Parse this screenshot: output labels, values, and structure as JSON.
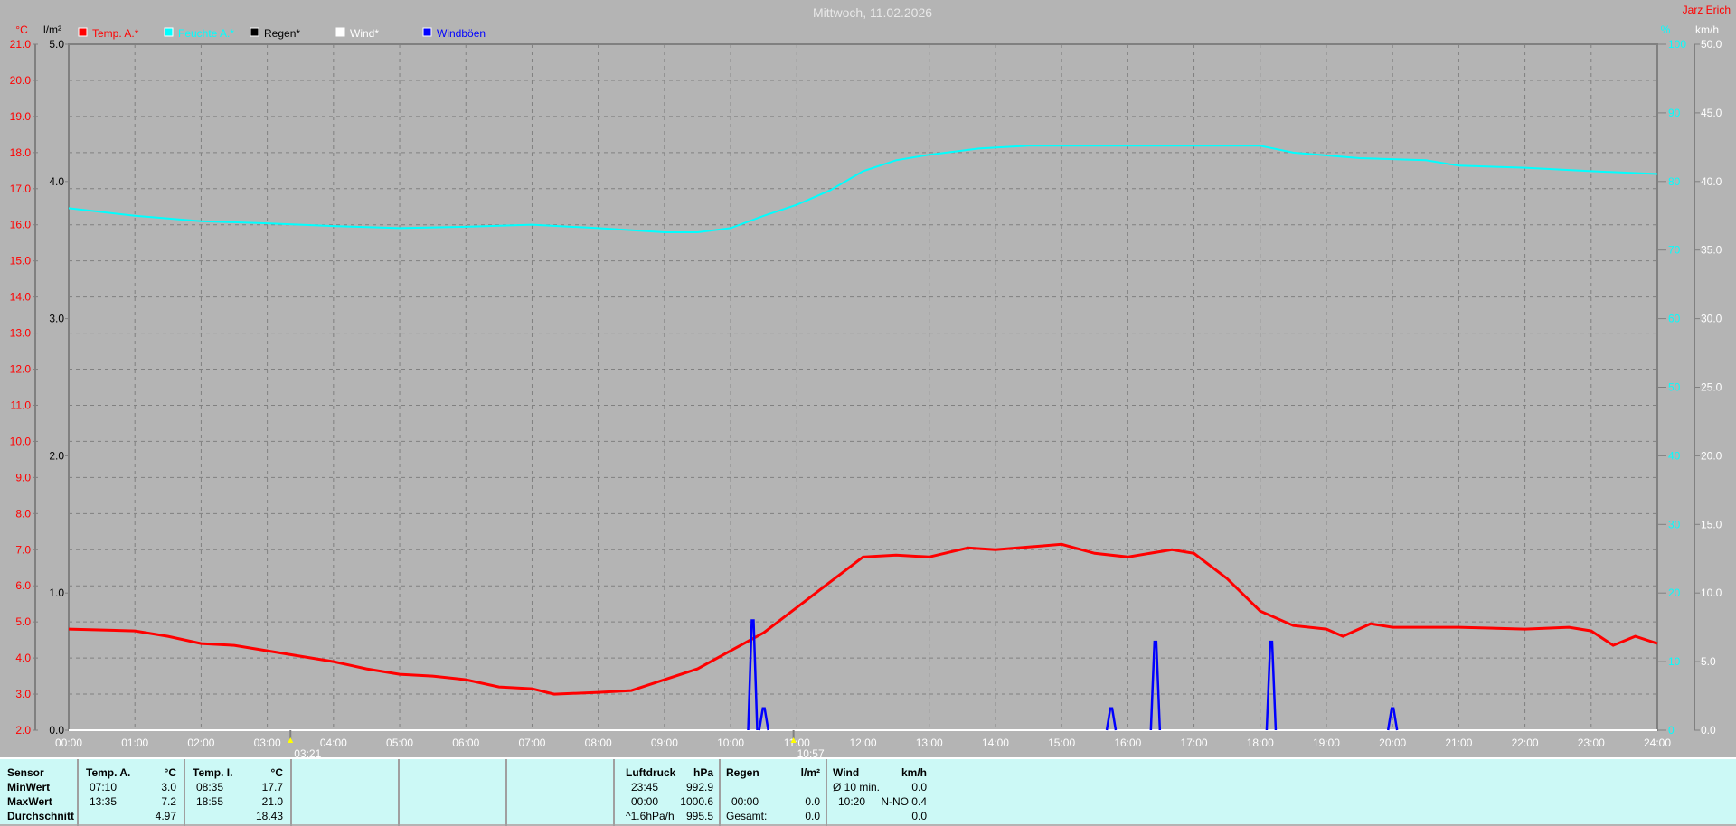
{
  "header": {
    "title": "Mittwoch, 11.02.2026",
    "station": "Jarz Erich"
  },
  "colors": {
    "temp": "#ff0000",
    "humidity": "#00ffff",
    "rain": "#000000",
    "wind": "#ffffff",
    "gusts": "#0000ff",
    "background": "#b4b4b4",
    "table_bg": "#ccf9f6"
  },
  "chart_data": {
    "type": "line",
    "title": "Mittwoch, 11.02.2026",
    "grid": true,
    "legend_placement": "top-left",
    "legend": [
      {
        "label": "Temp. A.*",
        "color": "#ff0000"
      },
      {
        "label": "Feuchte A.*",
        "color": "#00ffff"
      },
      {
        "label": "Regen*",
        "color": "#000000"
      },
      {
        "label": "Wind*",
        "color": "#ffffff"
      },
      {
        "label": "Windböen",
        "color": "#0000ff"
      }
    ],
    "axes": {
      "temp": {
        "unit": "°C",
        "range": [
          2.0,
          21.0
        ],
        "ticks": [
          "21.0",
          "20.0",
          "19.0",
          "18.0",
          "17.0",
          "16.0",
          "15.0",
          "14.0",
          "13.0",
          "12.0",
          "11.0",
          "10.0",
          "9.0",
          "8.0",
          "7.0",
          "6.0",
          "5.0",
          "4.0",
          "3.0",
          "2.0"
        ]
      },
      "rain": {
        "unit": "l/m²",
        "range": [
          0.0,
          5.0
        ],
        "ticks": [
          "5.0",
          "4.0",
          "3.0",
          "2.0",
          "1.0",
          "0.0"
        ]
      },
      "humidity": {
        "unit": "%",
        "range": [
          0,
          100
        ],
        "ticks": [
          "100",
          "90",
          "80",
          "70",
          "60",
          "50",
          "40",
          "30",
          "20",
          "10",
          "0"
        ]
      },
      "wind": {
        "unit": "km/h",
        "range": [
          0.0,
          50.0
        ],
        "ticks": [
          "50.0",
          "45.0",
          "40.0",
          "35.0",
          "30.0",
          "25.0",
          "20.0",
          "15.0",
          "10.0",
          "5.0",
          "0.0"
        ]
      },
      "x": {
        "ticks": [
          "00:00",
          "01:00",
          "02:00",
          "03:00",
          "04:00",
          "05:00",
          "06:00",
          "07:00",
          "08:00",
          "09:00",
          "10:00",
          "11:00",
          "12:00",
          "13:00",
          "14:00",
          "15:00",
          "16:00",
          "17:00",
          "18:00",
          "19:00",
          "20:00",
          "21:00",
          "22:00",
          "23:00",
          "24:00"
        ]
      }
    },
    "markers": [
      {
        "label": "03:21",
        "time": "03:21",
        "icon": "moonrise-icon"
      },
      {
        "label": "10:57",
        "time": "10:57",
        "icon": "moonset-icon"
      }
    ],
    "series": [
      {
        "name": "Temp. A.*",
        "axis": "temp",
        "points": [
          [
            "00:00",
            4.8
          ],
          [
            "01:00",
            4.75
          ],
          [
            "01:30",
            4.6
          ],
          [
            "02:00",
            4.4
          ],
          [
            "02:30",
            4.35
          ],
          [
            "03:00",
            4.2
          ],
          [
            "03:30",
            4.05
          ],
          [
            "04:00",
            3.9
          ],
          [
            "04:30",
            3.7
          ],
          [
            "05:00",
            3.55
          ],
          [
            "05:30",
            3.5
          ],
          [
            "06:00",
            3.4
          ],
          [
            "06:30",
            3.2
          ],
          [
            "07:00",
            3.15
          ],
          [
            "07:20",
            3.0
          ],
          [
            "08:00",
            3.05
          ],
          [
            "08:30",
            3.1
          ],
          [
            "09:00",
            3.4
          ],
          [
            "09:30",
            3.7
          ],
          [
            "10:00",
            4.2
          ],
          [
            "10:30",
            4.7
          ],
          [
            "11:00",
            5.4
          ],
          [
            "11:30",
            6.1
          ],
          [
            "12:00",
            6.8
          ],
          [
            "12:30",
            6.85
          ],
          [
            "13:00",
            6.8
          ],
          [
            "13:35",
            7.05
          ],
          [
            "14:00",
            7.0
          ],
          [
            "15:00",
            7.15
          ],
          [
            "15:30",
            6.9
          ],
          [
            "16:00",
            6.8
          ],
          [
            "16:40",
            7.0
          ],
          [
            "17:00",
            6.9
          ],
          [
            "17:30",
            6.2
          ],
          [
            "18:00",
            5.3
          ],
          [
            "18:30",
            4.9
          ],
          [
            "19:00",
            4.8
          ],
          [
            "19:15",
            4.6
          ],
          [
            "19:40",
            4.95
          ],
          [
            "20:00",
            4.85
          ],
          [
            "21:00",
            4.85
          ],
          [
            "22:00",
            4.8
          ],
          [
            "22:40",
            4.85
          ],
          [
            "23:00",
            4.75
          ],
          [
            "23:20",
            4.35
          ],
          [
            "23:40",
            4.6
          ],
          [
            "24:00",
            4.4
          ]
        ]
      },
      {
        "name": "Feuchte A.*",
        "axis": "humidity",
        "points": [
          [
            "00:00",
            76.1
          ],
          [
            "01:00",
            75.0
          ],
          [
            "02:00",
            74.2
          ],
          [
            "03:00",
            73.9
          ],
          [
            "04:00",
            73.5
          ],
          [
            "05:00",
            73.2
          ],
          [
            "06:00",
            73.4
          ],
          [
            "07:00",
            73.7
          ],
          [
            "08:00",
            73.2
          ],
          [
            "09:00",
            72.6
          ],
          [
            "09:30",
            72.6
          ],
          [
            "10:00",
            73.2
          ],
          [
            "10:30",
            75.0
          ],
          [
            "11:00",
            76.6
          ],
          [
            "11:30",
            78.7
          ],
          [
            "12:00",
            81.5
          ],
          [
            "12:30",
            83.1
          ],
          [
            "13:00",
            83.9
          ],
          [
            "13:45",
            84.8
          ],
          [
            "14:30",
            85.2
          ],
          [
            "18:00",
            85.2
          ],
          [
            "18:30",
            84.2
          ],
          [
            "19:30",
            83.4
          ],
          [
            "20:30",
            83.1
          ],
          [
            "21:00",
            82.3
          ],
          [
            "22:00",
            82.0
          ],
          [
            "23:00",
            81.5
          ],
          [
            "24:00",
            81.1
          ]
        ]
      },
      {
        "name": "Regen*",
        "axis": "rain",
        "points": [
          [
            "00:00",
            0.0
          ],
          [
            "24:00",
            0.0
          ]
        ]
      },
      {
        "name": "Wind*",
        "axis": "wind",
        "points": [
          [
            "00:00",
            0.0
          ],
          [
            "24:00",
            0.0
          ]
        ]
      },
      {
        "name": "Windböen",
        "axis": "wind",
        "spikes": [
          [
            "10:20",
            8.0
          ],
          [
            "10:30",
            1.6
          ],
          [
            "15:45",
            1.6
          ],
          [
            "16:25",
            6.45
          ],
          [
            "18:10",
            6.45
          ],
          [
            "20:00",
            1.6
          ]
        ]
      }
    ]
  },
  "table": {
    "sensor": {
      "header": "Sensor",
      "min": "MinWert",
      "max": "MaxWert",
      "avg": "Durchschnitt"
    },
    "temp_a": {
      "header": "Temp. A.",
      "unit": "°C",
      "min_time": "07:10",
      "min": "3.0",
      "max_time": "13:35",
      "max": "7.2",
      "avg": "4.97"
    },
    "temp_i": {
      "header": "Temp. I.",
      "unit": "°C",
      "min_time": "08:35",
      "min": "17.7",
      "max_time": "18:55",
      "max": "21.0",
      "avg": "18.43"
    },
    "pressure": {
      "header": "Luftdruck",
      "unit": "hPa",
      "min_time": "23:45",
      "min": "992.9",
      "max_time": "00:00",
      "max": "1000.6",
      "trend": "^1.6hPa/h",
      "avg": "995.5"
    },
    "rain": {
      "header": "Regen",
      "unit": "l/m²",
      "max_time": "00:00",
      "max": "0.0",
      "total_label": "Gesamt:",
      "total": "0.0"
    },
    "wind": {
      "header": "Wind",
      "unit": "km/h",
      "avg_label": "Ø 10 min.",
      "avg": "0.0",
      "max_time": "10:20",
      "max": "N-NO 0.4",
      "last": "0.0"
    }
  }
}
